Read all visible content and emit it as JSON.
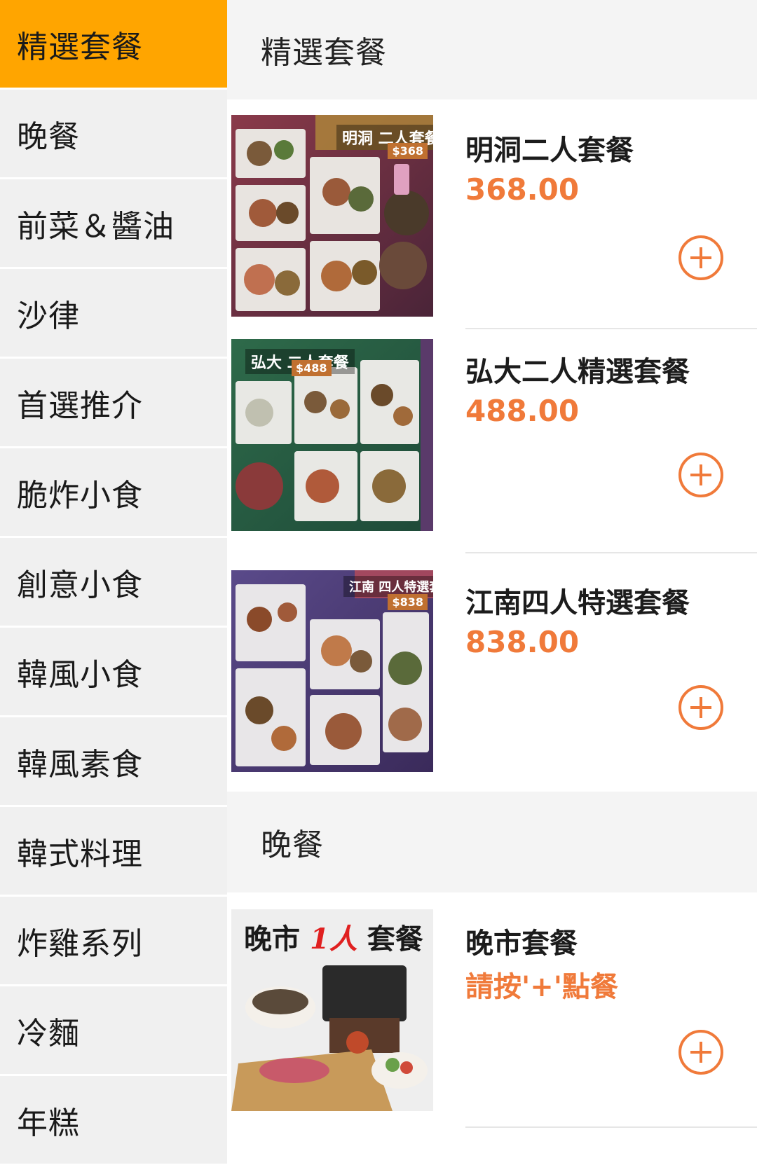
{
  "sidebar": {
    "items": [
      {
        "label": "精選套餐",
        "active": true
      },
      {
        "label": "晚餐"
      },
      {
        "label": "前菜＆醬油"
      },
      {
        "label": "沙律"
      },
      {
        "label": "首選推介"
      },
      {
        "label": "脆炸小食"
      },
      {
        "label": "創意小食"
      },
      {
        "label": "韓風小食"
      },
      {
        "label": "韓風素食"
      },
      {
        "label": "韓式料理"
      },
      {
        "label": "炸雞系列"
      },
      {
        "label": "冷麵"
      },
      {
        "label": "年糕"
      }
    ]
  },
  "main": {
    "sections": [
      {
        "title": "精選套餐",
        "items": [
          {
            "name": "明洞二人套餐",
            "price": "368.00",
            "poster_label": "明洞 二人套餐",
            "poster_price": "$368"
          },
          {
            "name": "弘大二人精選套餐",
            "price": "488.00",
            "poster_label": "弘大 二人套餐",
            "poster_price": "$488"
          },
          {
            "name": "江南四人特選套餐",
            "price": "838.00",
            "poster_label": "江南 四人特選套餐",
            "poster_price": "$838"
          }
        ]
      },
      {
        "title": "晚餐",
        "items": [
          {
            "name": "晚市套餐",
            "price": "請按'+'點餐",
            "poster_label_a": "晚市",
            "poster_label_b": "1人",
            "poster_label_c": "套餐"
          }
        ]
      }
    ]
  },
  "colors": {
    "accent": "#ffa500",
    "price": "#f07a3a",
    "sidebar_bg": "#f0f0f0"
  },
  "icons": {
    "add": "plus-circle-icon"
  }
}
